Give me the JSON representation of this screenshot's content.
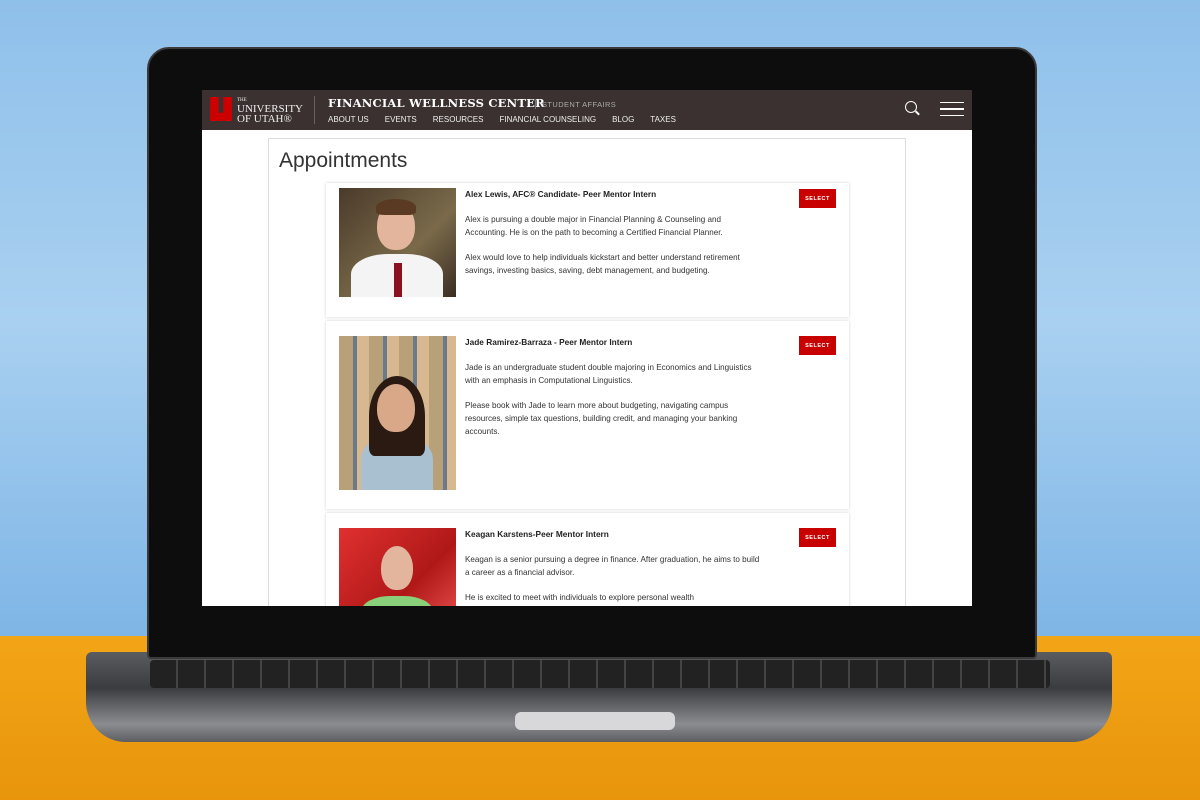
{
  "header": {
    "logo_the": "THE",
    "logo_line1": "UNIVERSITY",
    "logo_line2": "OF UTAH®",
    "site_title": "FINANCIAL WELLNESS CENTER",
    "affiliation": "STUDENT AFFAIRS",
    "nav": [
      {
        "label": "ABOUT US"
      },
      {
        "label": "EVENTS"
      },
      {
        "label": "RESOURCES"
      },
      {
        "label": "FINANCIAL COUNSELING"
      },
      {
        "label": "BLOG"
      },
      {
        "label": "TAXES"
      }
    ],
    "icons": {
      "search": "search-icon",
      "menu": "hamburger-menu-icon"
    }
  },
  "main": {
    "title": "Appointments",
    "mentors": [
      {
        "name": "Alex Lewis, AFC® Candidate- Peer Mentor Intern",
        "paragraphs": [
          "Alex is pursuing a double major in Financial Planning & Counseling and Accounting. He is on the path to becoming a Certified Financial Planner.",
          "Alex would love to help individuals kickstart and better understand retirement savings, investing basics, saving, debt management, and budgeting."
        ],
        "button": "SELECT"
      },
      {
        "name": "Jade Ramirez-Barraza - Peer Mentor Intern",
        "paragraphs": [
          "Jade is an undergraduate student double majoring in Economics and Linguistics with an emphasis in Computational Linguistics.",
          "Please book with Jade to learn more about budgeting, navigating campus resources, simple tax questions, building credit, and managing your banking accounts."
        ],
        "button": "SELECT"
      },
      {
        "name": "Keagan Karstens-Peer Mentor Intern",
        "paragraphs": [
          "Keagan is a senior pursuing a degree in finance. After graduation, he aims to build a career as a financial advisor.",
          "He is excited to meet with individuals to explore personal wealth"
        ],
        "button": "SELECT"
      }
    ]
  },
  "colors": {
    "header_bg": "#3a3130",
    "accent_red": "#c90000",
    "desk": "#f2a516",
    "sky": "#8fc0ea"
  }
}
